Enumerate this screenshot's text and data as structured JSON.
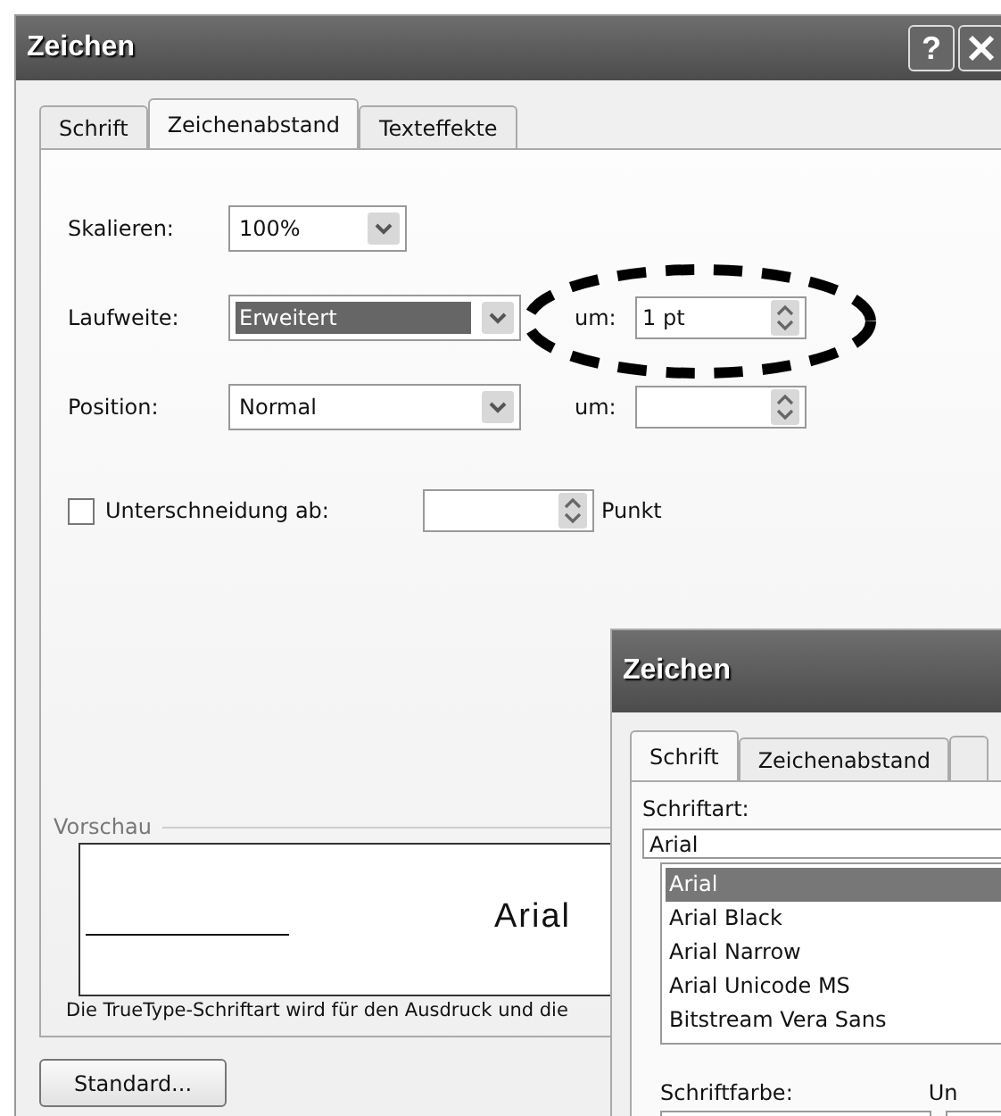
{
  "dialog": {
    "title": "Zeichen",
    "help_button": "?"
  },
  "tabs": [
    {
      "label": "Schrift",
      "selected": false
    },
    {
      "label": "Zeichenabstand",
      "selected": true
    },
    {
      "label": "Texteffekte",
      "selected": false
    }
  ],
  "rows": [
    {
      "label": "Skalieren:",
      "kind": "dropdown",
      "value": "100%",
      "selected": false
    },
    {
      "label": "Laufweite:",
      "kind": "dropdown",
      "value": "Erweitert",
      "selected": true,
      "extra": {
        "label": "um:",
        "value": "1 pt",
        "circled": true
      }
    },
    {
      "label": "Position:",
      "kind": "dropdown",
      "value": "Normal",
      "selected": false,
      "extra": {
        "label": "um:"
      }
    }
  ],
  "kerning": {
    "label": "Unterschneidung ab:",
    "checked": false,
    "unit": "Punkt"
  },
  "preview": {
    "legend": "Vorschau",
    "sample": "Arial",
    "note": "Die TrueType-Schriftart wird für den Ausdruck und die"
  },
  "buttons": [
    "Standard..."
  ],
  "overlay": {
    "title": "Zeichen",
    "tabs": [
      {
        "label": "Schrift",
        "selected": true
      },
      {
        "label": "Zeichenabstand",
        "selected": false
      }
    ],
    "font_label": "Schriftart:",
    "font_value": "Arial",
    "fonts": [
      {
        "name": "Arial",
        "selected": true
      },
      {
        "name": "Arial Black",
        "selected": false
      },
      {
        "name": "Arial Narrow",
        "selected": false
      },
      {
        "name": "Arial Unicode MS",
        "selected": false
      },
      {
        "name": "Bitstream Vera Sans",
        "selected": false
      }
    ],
    "color_label": "Schriftfarbe:",
    "column_2_label": "Un"
  }
}
